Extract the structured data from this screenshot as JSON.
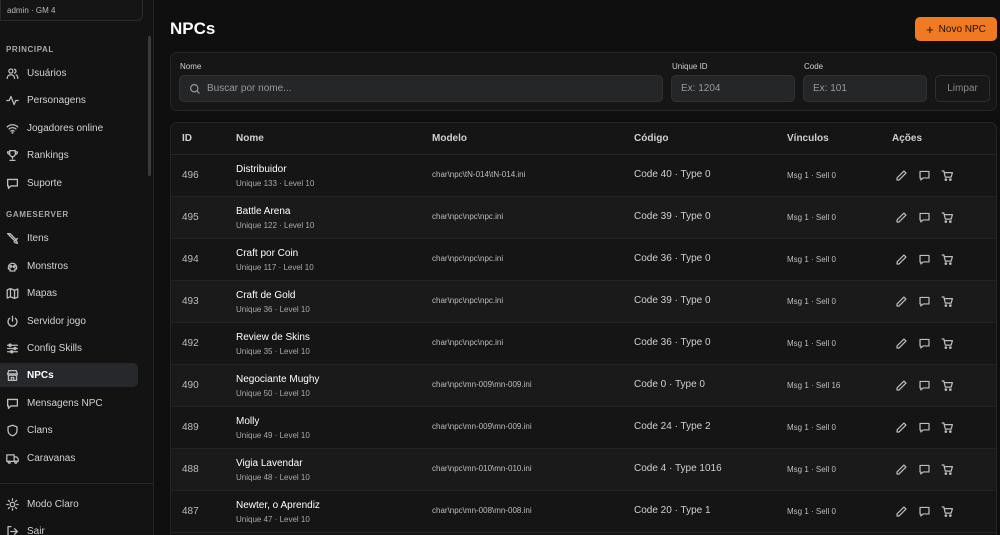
{
  "user": {
    "label": "admin · GM 4"
  },
  "sidebar": {
    "sections": [
      {
        "title": "PRINCIPAL",
        "items": [
          {
            "label": "Usuários",
            "icon": "users-icon"
          },
          {
            "label": "Personagens",
            "icon": "activity-icon"
          },
          {
            "label": "Jogadores online",
            "icon": "wifi-icon"
          },
          {
            "label": "Rankings",
            "icon": "trophy-icon"
          },
          {
            "label": "Suporte",
            "icon": "message-square-icon"
          }
        ]
      },
      {
        "title": "GAMESERVER",
        "items": [
          {
            "label": "Itens",
            "icon": "sword-icon"
          },
          {
            "label": "Monstros",
            "icon": "skull-icon"
          },
          {
            "label": "Mapas",
            "icon": "map-icon"
          },
          {
            "label": "Servidor jogo",
            "icon": "power-icon"
          },
          {
            "label": "Config Skills",
            "icon": "sliders-icon"
          },
          {
            "label": "NPCs",
            "icon": "store-icon",
            "active": true
          },
          {
            "label": "Mensagens NPC",
            "icon": "message-square-icon"
          },
          {
            "label": "Clans",
            "icon": "shield-icon"
          },
          {
            "label": "Caravanas",
            "icon": "truck-icon"
          }
        ]
      }
    ],
    "footer": [
      {
        "label": "Modo Claro",
        "icon": "sun-icon"
      },
      {
        "label": "Sair",
        "icon": "log-out-icon"
      }
    ]
  },
  "page": {
    "title": "NPCs",
    "new_button": "Novo NPC"
  },
  "filters": {
    "name_label": "Nome",
    "name_placeholder": "Buscar por nome...",
    "uid_label": "Unique ID",
    "uid_placeholder": "Ex: 1204",
    "code_label": "Code",
    "code_placeholder": "Ex: 101",
    "clear_button": "Limpar"
  },
  "table": {
    "columns": [
      "ID",
      "Nome",
      "Modelo",
      "Código",
      "Vínculos",
      "Ações"
    ],
    "rows": [
      {
        "id": "496",
        "name": "Distribuidor",
        "sub": "Unique 133 · Level 10",
        "model": "char\\npc\\tN-014\\tN-014.ini",
        "code": "Code 40 · Type 0",
        "links": "Msg 1 · Sell 0"
      },
      {
        "id": "495",
        "name": "Battle Arena",
        "sub": "Unique 122 · Level 10",
        "model": "char\\npc\\npc\\npc.ini",
        "code": "Code 39 · Type 0",
        "links": "Msg 1 · Sell 0"
      },
      {
        "id": "494",
        "name": "Craft por Coin",
        "sub": "Unique 117 · Level 10",
        "model": "char\\npc\\npc\\npc.ini",
        "code": "Code 36 · Type 0",
        "links": "Msg 1 · Sell 0"
      },
      {
        "id": "493",
        "name": "Craft de Gold",
        "sub": "Unique 36 · Level 10",
        "model": "char\\npc\\npc\\npc.ini",
        "code": "Code 39 · Type 0",
        "links": "Msg 1 · Sell 0"
      },
      {
        "id": "492",
        "name": "Review de Skins",
        "sub": "Unique 35 · Level 10",
        "model": "char\\npc\\npc\\npc.ini",
        "code": "Code 36 · Type 0",
        "links": "Msg 1 · Sell 0"
      },
      {
        "id": "490",
        "name": "Negociante Mughy",
        "sub": "Unique 50 · Level 10",
        "model": "char\\npc\\mn-009\\mn-009.ini",
        "code": "Code 0 · Type 0",
        "links": "Msg 1 · Sell 16"
      },
      {
        "id": "489",
        "name": "Molly",
        "sub": "Unique 49 · Level 10",
        "model": "char\\npc\\mn-009\\mn-009.ini",
        "code": "Code 24 · Type 2",
        "links": "Msg 1 · Sell 0"
      },
      {
        "id": "488",
        "name": "Vigia Lavendar",
        "sub": "Unique 48 · Level 10",
        "model": "char\\npc\\mn-010\\mn-010.ini",
        "code": "Code 4 · Type 1016",
        "links": "Msg 1 · Sell 0"
      },
      {
        "id": "487",
        "name": "Newter, o Aprendiz",
        "sub": "Unique 47 · Level 10",
        "model": "char\\npc\\mn-008\\mn-008.ini",
        "code": "Code 20 · Type 1",
        "links": "Msg 1 · Sell 0"
      }
    ]
  },
  "colors": {
    "accent": "#f07a22",
    "background": "#0f0f0f",
    "sidebar_active": "#26282b"
  }
}
